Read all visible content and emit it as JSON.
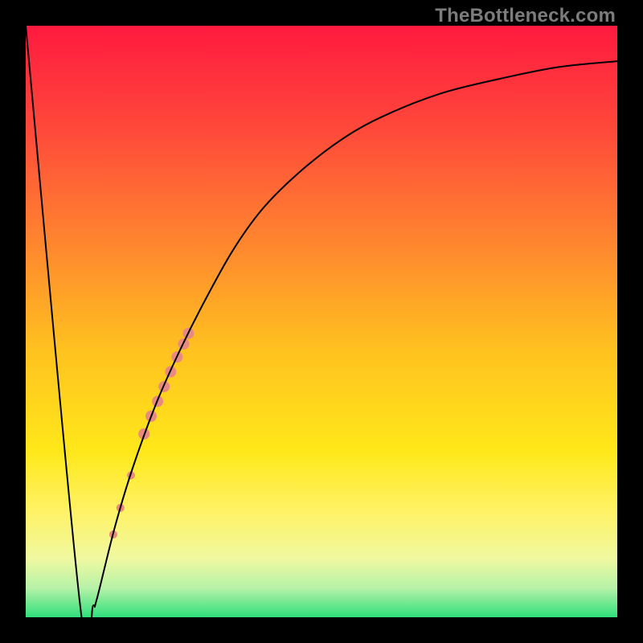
{
  "watermark": {
    "text": "TheBottleneck.com"
  },
  "chart_data": {
    "type": "line",
    "title": "",
    "xlabel": "",
    "ylabel": "",
    "xlim": [
      0,
      100
    ],
    "ylim": [
      0,
      100
    ],
    "grid": false,
    "legend": false,
    "annotations": [],
    "background_gradient": {
      "orientation": "vertical",
      "stops": [
        {
          "pos": 0.0,
          "color": "#ff1a3f"
        },
        {
          "pos": 0.18,
          "color": "#ff4a3a"
        },
        {
          "pos": 0.38,
          "color": "#ff8a2e"
        },
        {
          "pos": 0.55,
          "color": "#ffc21f"
        },
        {
          "pos": 0.72,
          "color": "#ffe81a"
        },
        {
          "pos": 0.82,
          "color": "#fff265"
        },
        {
          "pos": 0.9,
          "color": "#f0f9a0"
        },
        {
          "pos": 0.95,
          "color": "#b8f2a8"
        },
        {
          "pos": 1.0,
          "color": "#2fe07b"
        }
      ]
    },
    "series": [
      {
        "name": "curve",
        "stroke": "#000000",
        "stroke_width": 2,
        "points": [
          {
            "x": 0.0,
            "y": 100.0
          },
          {
            "x": 9.2,
            "y": 2.0
          },
          {
            "x": 11.4,
            "y": 2.0
          },
          {
            "x": 12.0,
            "y": 3.0
          },
          {
            "x": 15.0,
            "y": 15.0
          },
          {
            "x": 18.0,
            "y": 25.0
          },
          {
            "x": 22.0,
            "y": 36.0
          },
          {
            "x": 26.0,
            "y": 45.0
          },
          {
            "x": 30.0,
            "y": 53.0
          },
          {
            "x": 35.0,
            "y": 62.0
          },
          {
            "x": 40.0,
            "y": 69.0
          },
          {
            "x": 46.0,
            "y": 75.0
          },
          {
            "x": 53.0,
            "y": 80.5
          },
          {
            "x": 60.0,
            "y": 84.5
          },
          {
            "x": 70.0,
            "y": 88.5
          },
          {
            "x": 80.0,
            "y": 91.0
          },
          {
            "x": 90.0,
            "y": 93.0
          },
          {
            "x": 100.0,
            "y": 94.0
          }
        ]
      }
    ],
    "highlight_segment": {
      "color": "#e98a80",
      "on_series": "curve",
      "segments": [
        {
          "x": 20.0,
          "y": 31.0,
          "r": 7
        },
        {
          "x": 27.5,
          "y": 48.0,
          "r": 7
        },
        {
          "x": 21.2,
          "y": 34.0,
          "r": 7
        },
        {
          "x": 22.3,
          "y": 36.5,
          "r": 7
        },
        {
          "x": 23.4,
          "y": 39.0,
          "r": 7
        },
        {
          "x": 24.5,
          "y": 41.5,
          "r": 7
        },
        {
          "x": 25.6,
          "y": 44.0,
          "r": 7
        },
        {
          "x": 26.7,
          "y": 46.2,
          "r": 7
        },
        {
          "x": 17.8,
          "y": 24.0,
          "r": 5
        },
        {
          "x": 16.0,
          "y": 18.5,
          "r": 5
        },
        {
          "x": 14.8,
          "y": 14.0,
          "r": 5
        }
      ]
    }
  }
}
